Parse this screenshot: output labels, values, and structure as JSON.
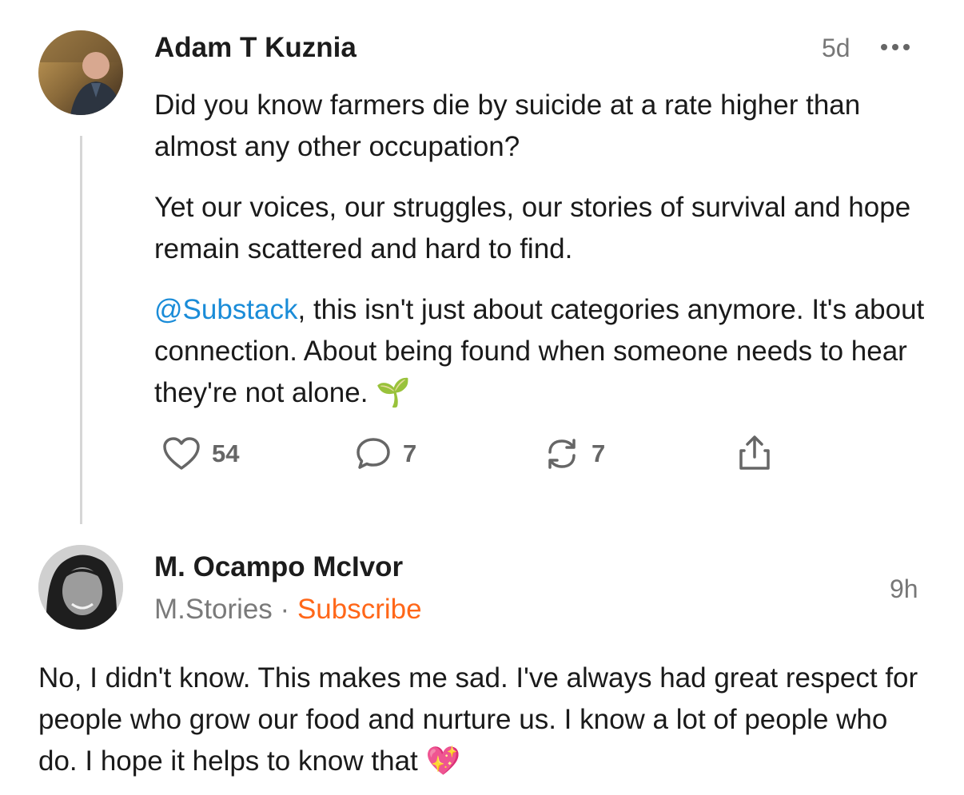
{
  "post": {
    "author": "Adam T Kuznia",
    "time": "5d",
    "paragraphs": {
      "p1": "Did you know farmers die by suicide at a rate higher than almost any other occupation?",
      "p2": "Yet our voices, our struggles, our stories of survival and hope remain scattered and hard to find.",
      "p3_mention": "@Substack",
      "p3_rest": ", this isn't just about categories anymore. It's about connection. About being found when someone needs to hear they're not alone. ",
      "p3_emoji": "🌱"
    },
    "actions": {
      "likes": "54",
      "comments": "7",
      "restacks": "7"
    },
    "icons": [
      "avatar",
      "more-dots-icon",
      "heart-icon",
      "comment-icon",
      "restack-icon",
      "share-icon"
    ]
  },
  "reply": {
    "author": "M. Ocampo McIvor",
    "publication": "M.Stories",
    "separator": "·",
    "subscribe": "Subscribe",
    "time": "9h",
    "text": "No, I didn't know. This makes me sad. I've always had great respect for people who grow our food and nurture us. I know a lot of people who do. I hope it helps to know that ",
    "emoji": "💖"
  },
  "colors": {
    "accent_link": "#1a8cd8",
    "subscribe": "#ff6719",
    "muted": "#777777"
  }
}
